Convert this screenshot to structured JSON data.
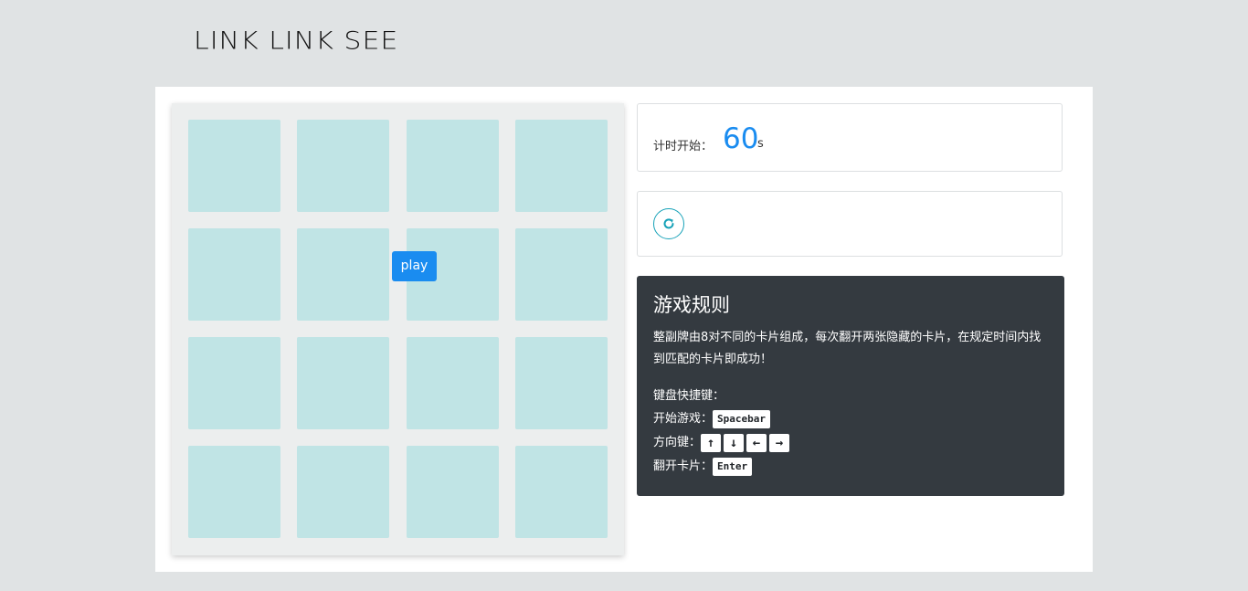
{
  "header": {
    "logo_text": "LINK LINK SEE"
  },
  "board": {
    "play_label": "play",
    "card_color": "#c0e4e5"
  },
  "timer": {
    "label": "计时开始：",
    "value": "60",
    "unit": "s"
  },
  "controls": {
    "refresh_icon": "refresh-icon"
  },
  "rules": {
    "title": "游戏规则",
    "description": "整副牌由8对不同的卡片组成，每次翻开两张隐藏的卡片，在规定时间内找到匹配的卡片即成功！",
    "shortcuts_label": "键盘快捷键：",
    "start_label": "开始游戏：",
    "start_key": "Spacebar",
    "arrows_label": "方向键：",
    "arrow_keys": [
      "↑",
      "↓",
      "←",
      "→"
    ],
    "flip_label": "翻开卡片：",
    "flip_key": "Enter"
  },
  "colors": {
    "accent": "#1a8cf0",
    "teal": "#17a2b8",
    "dark_panel": "#343a40"
  }
}
